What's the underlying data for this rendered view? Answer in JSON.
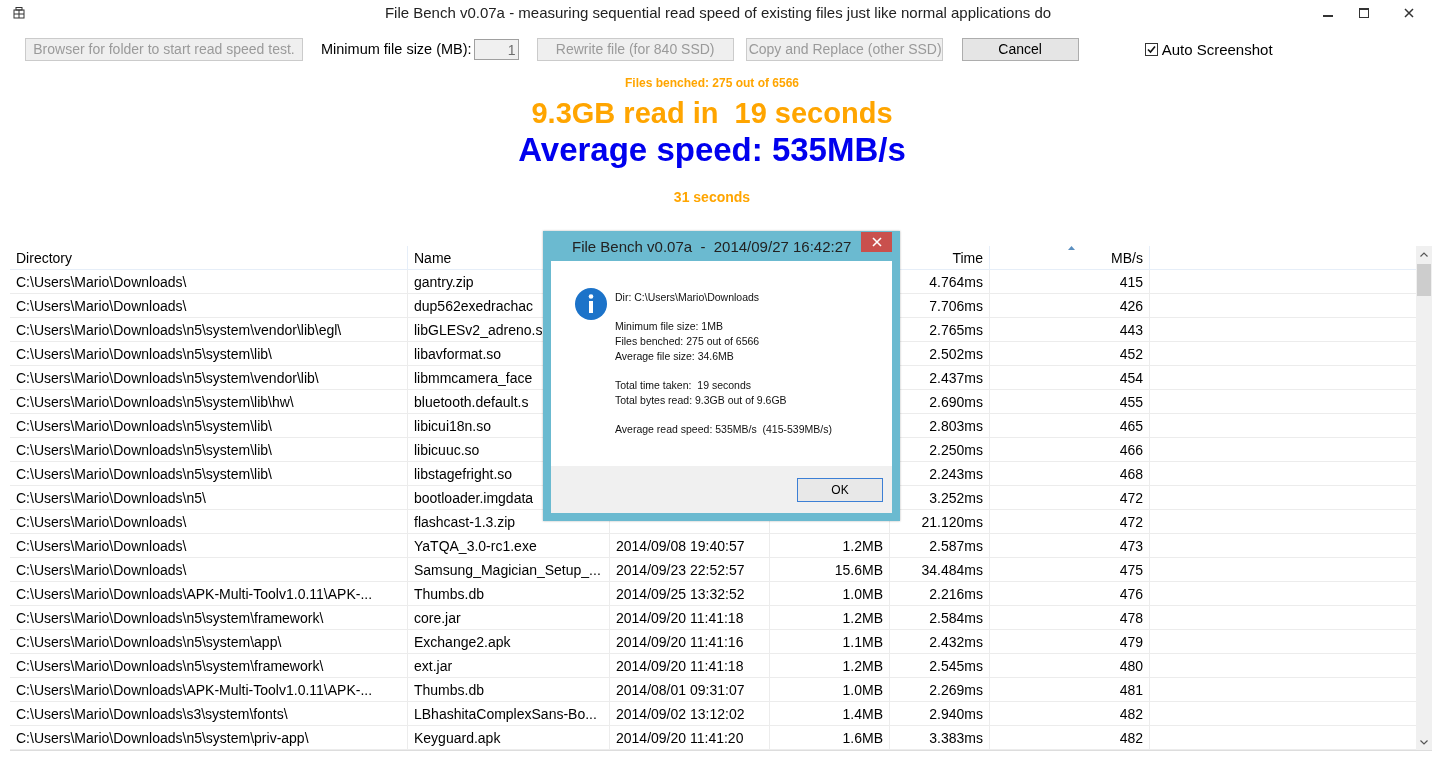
{
  "window": {
    "title": "File Bench v0.07a - measuring sequential read speed of existing files just like normal applications do"
  },
  "toolbar": [
    {
      "kind": "button",
      "label": "Browser for folder to start read speed test.",
      "disabled": true
    },
    {
      "kind": "label",
      "label": "Minimum file size (MB):"
    },
    {
      "kind": "field",
      "value": "1",
      "disabled": true
    },
    {
      "kind": "button",
      "label": "Rewrite file (for 840 SSD)",
      "disabled": true
    },
    {
      "kind": "button",
      "label": "Copy and Replace (other SSD)",
      "disabled": true
    },
    {
      "kind": "button",
      "label": "Cancel",
      "disabled": false
    },
    {
      "kind": "checkbox",
      "label": "Auto Screenshot",
      "checked": true
    }
  ],
  "summary": {
    "files_benched": "Files benched: 275 out of 6566",
    "read_line": "9.3GB read in  19 seconds",
    "speed_line": "Average speed: 535MB/s",
    "elapsed": "31 seconds"
  },
  "table": {
    "columns": [
      {
        "label": "Directory",
        "sorted": false
      },
      {
        "label": "Name",
        "sorted": false
      },
      {},
      {},
      {
        "label": "Time",
        "sorted": false
      },
      {
        "label": "MB/s",
        "sorted": true
      }
    ],
    "rows": [
      {
        "directory": "C:\\Users\\Mario\\Downloads\\",
        "name": "gantry.zip",
        "time": "4.764ms",
        "mb_s": "415"
      },
      {
        "directory": "C:\\Users\\Mario\\Downloads\\",
        "name": "dup562exedrachac",
        "time": "7.706ms",
        "mb_s": "426"
      },
      {
        "directory": "C:\\Users\\Mario\\Downloads\\n5\\system\\vendor\\lib\\egl\\",
        "name": "libGLESv2_adreno.s",
        "time": "2.765ms",
        "mb_s": "443"
      },
      {
        "directory": "C:\\Users\\Mario\\Downloads\\n5\\system\\lib\\",
        "name": "libavformat.so",
        "time": "2.502ms",
        "mb_s": "452"
      },
      {
        "directory": "C:\\Users\\Mario\\Downloads\\n5\\system\\vendor\\lib\\",
        "name": "libmmcamera_face",
        "time": "2.437ms",
        "mb_s": "454"
      },
      {
        "directory": "C:\\Users\\Mario\\Downloads\\n5\\system\\lib\\hw\\",
        "name": "bluetooth.default.s",
        "time": "2.690ms",
        "mb_s": "455"
      },
      {
        "directory": "C:\\Users\\Mario\\Downloads\\n5\\system\\lib\\",
        "name": "libicui18n.so",
        "time": "2.803ms",
        "mb_s": "465"
      },
      {
        "directory": "C:\\Users\\Mario\\Downloads\\n5\\system\\lib\\",
        "name": "libicuuc.so",
        "time": "2.250ms",
        "mb_s": "466"
      },
      {
        "directory": "C:\\Users\\Mario\\Downloads\\n5\\system\\lib\\",
        "name": "libstagefright.so",
        "time": "2.243ms",
        "mb_s": "468"
      },
      {
        "directory": "C:\\Users\\Mario\\Downloads\\n5\\",
        "name": "bootloader.imgdata",
        "time": "3.252ms",
        "mb_s": "472"
      },
      {
        "directory": "C:\\Users\\Mario\\Downloads\\",
        "name": "flashcast-1.3.zip",
        "time": "21.120ms",
        "mb_s": "472"
      },
      {
        "directory": "C:\\Users\\Mario\\Downloads\\",
        "name": "YaTQA_3.0-rc1.exe",
        "column_3": "2014/09/08 19:40:57",
        "column_4": "1.2MB",
        "time": "2.587ms",
        "mb_s": "473"
      },
      {
        "directory": "C:\\Users\\Mario\\Downloads\\",
        "name": "Samsung_Magician_Setup_...",
        "column_3": "2014/09/23 22:52:57",
        "column_4": "15.6MB",
        "time": "34.484ms",
        "mb_s": "475"
      },
      {
        "directory": "C:\\Users\\Mario\\Downloads\\APK-Multi-Toolv1.0.11\\APK-...",
        "name": "Thumbs.db",
        "column_3": "2014/09/25 13:32:52",
        "column_4": "1.0MB",
        "time": "2.216ms",
        "mb_s": "476"
      },
      {
        "directory": "C:\\Users\\Mario\\Downloads\\n5\\system\\framework\\",
        "name": "core.jar",
        "column_3": "2014/09/20 11:41:18",
        "column_4": "1.2MB",
        "time": "2.584ms",
        "mb_s": "478"
      },
      {
        "directory": "C:\\Users\\Mario\\Downloads\\n5\\system\\app\\",
        "name": "Exchange2.apk",
        "column_3": "2014/09/20 11:41:16",
        "column_4": "1.1MB",
        "time": "2.432ms",
        "mb_s": "479"
      },
      {
        "directory": "C:\\Users\\Mario\\Downloads\\n5\\system\\framework\\",
        "name": "ext.jar",
        "column_3": "2014/09/20 11:41:18",
        "column_4": "1.2MB",
        "time": "2.545ms",
        "mb_s": "480"
      },
      {
        "directory": "C:\\Users\\Mario\\Downloads\\APK-Multi-Toolv1.0.11\\APK-...",
        "name": "Thumbs.db",
        "column_3": "2014/08/01 09:31:07",
        "column_4": "1.0MB",
        "time": "2.269ms",
        "mb_s": "481"
      },
      {
        "directory": "C:\\Users\\Mario\\Downloads\\s3\\system\\fonts\\",
        "name": "LBhashitaComplexSans-Bo...",
        "column_3": "2014/09/02 13:12:02",
        "column_4": "1.4MB",
        "time": "2.940ms",
        "mb_s": "482"
      },
      {
        "directory": "C:\\Users\\Mario\\Downloads\\n5\\system\\priv-app\\",
        "name": "Keyguard.apk",
        "column_3": "2014/09/20 11:41:20",
        "column_4": "1.6MB",
        "time": "3.383ms",
        "mb_s": "482"
      }
    ]
  },
  "dialog": {
    "title": "File Bench v0.07a  -  2014/09/27 16:42:27",
    "paragraphs": [
      [
        "Dir: C:\\Users\\Mario\\Downloads"
      ],
      [
        "Minimum file size: 1MB",
        "Files benched: 275 out of 6566",
        "Average file size: 34.6MB"
      ],
      [
        "Total time taken:  19 seconds",
        "Total bytes read: 9.3GB out of 9.6GB"
      ],
      [
        "Average read speed: 535MB/s  (415-539MB/s)"
      ]
    ],
    "button": "OK"
  }
}
